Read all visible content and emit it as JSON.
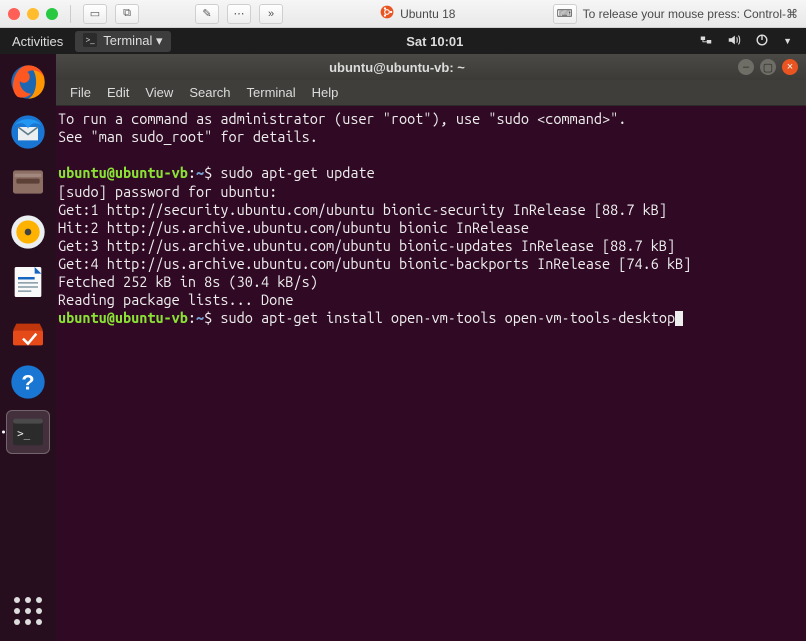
{
  "vm": {
    "title": "Ubuntu 18",
    "release_hint": "To release your mouse press: Control-⌘"
  },
  "gnome": {
    "activities": "Activities",
    "app_menu": "Terminal ▾",
    "clock": "Sat 10:01"
  },
  "dock": {
    "items": [
      {
        "name": "firefox"
      },
      {
        "name": "thunderbird"
      },
      {
        "name": "files"
      },
      {
        "name": "rhythmbox"
      },
      {
        "name": "libreoffice-writer"
      },
      {
        "name": "ubuntu-software"
      },
      {
        "name": "help"
      },
      {
        "name": "terminal",
        "active": true
      }
    ]
  },
  "terminal": {
    "title": "ubuntu@ubuntu-vb: ~",
    "menu": [
      "File",
      "Edit",
      "View",
      "Search",
      "Terminal",
      "Help"
    ],
    "lines": [
      {
        "type": "text",
        "text": "To run a command as administrator (user \"root\"), use \"sudo <command>\"."
      },
      {
        "type": "text",
        "text": "See \"man sudo_root\" for details."
      },
      {
        "type": "blank"
      },
      {
        "type": "prompt",
        "user": "ubuntu@ubuntu-vb",
        "path": "~",
        "cmd": "sudo apt-get update"
      },
      {
        "type": "text",
        "text": "[sudo] password for ubuntu:"
      },
      {
        "type": "text",
        "text": "Get:1 http://security.ubuntu.com/ubuntu bionic-security InRelease [88.7 kB]"
      },
      {
        "type": "text",
        "text": "Hit:2 http://us.archive.ubuntu.com/ubuntu bionic InRelease"
      },
      {
        "type": "text",
        "text": "Get:3 http://us.archive.ubuntu.com/ubuntu bionic-updates InRelease [88.7 kB]"
      },
      {
        "type": "text",
        "text": "Get:4 http://us.archive.ubuntu.com/ubuntu bionic-backports InRelease [74.6 kB]"
      },
      {
        "type": "text",
        "text": "Fetched 252 kB in 8s (30.4 kB/s)"
      },
      {
        "type": "text",
        "text": "Reading package lists... Done"
      },
      {
        "type": "prompt",
        "user": "ubuntu@ubuntu-vb",
        "path": "~",
        "cmd": "sudo apt-get install open-vm-tools open-vm-tools-desktop",
        "cursor": true
      }
    ]
  }
}
